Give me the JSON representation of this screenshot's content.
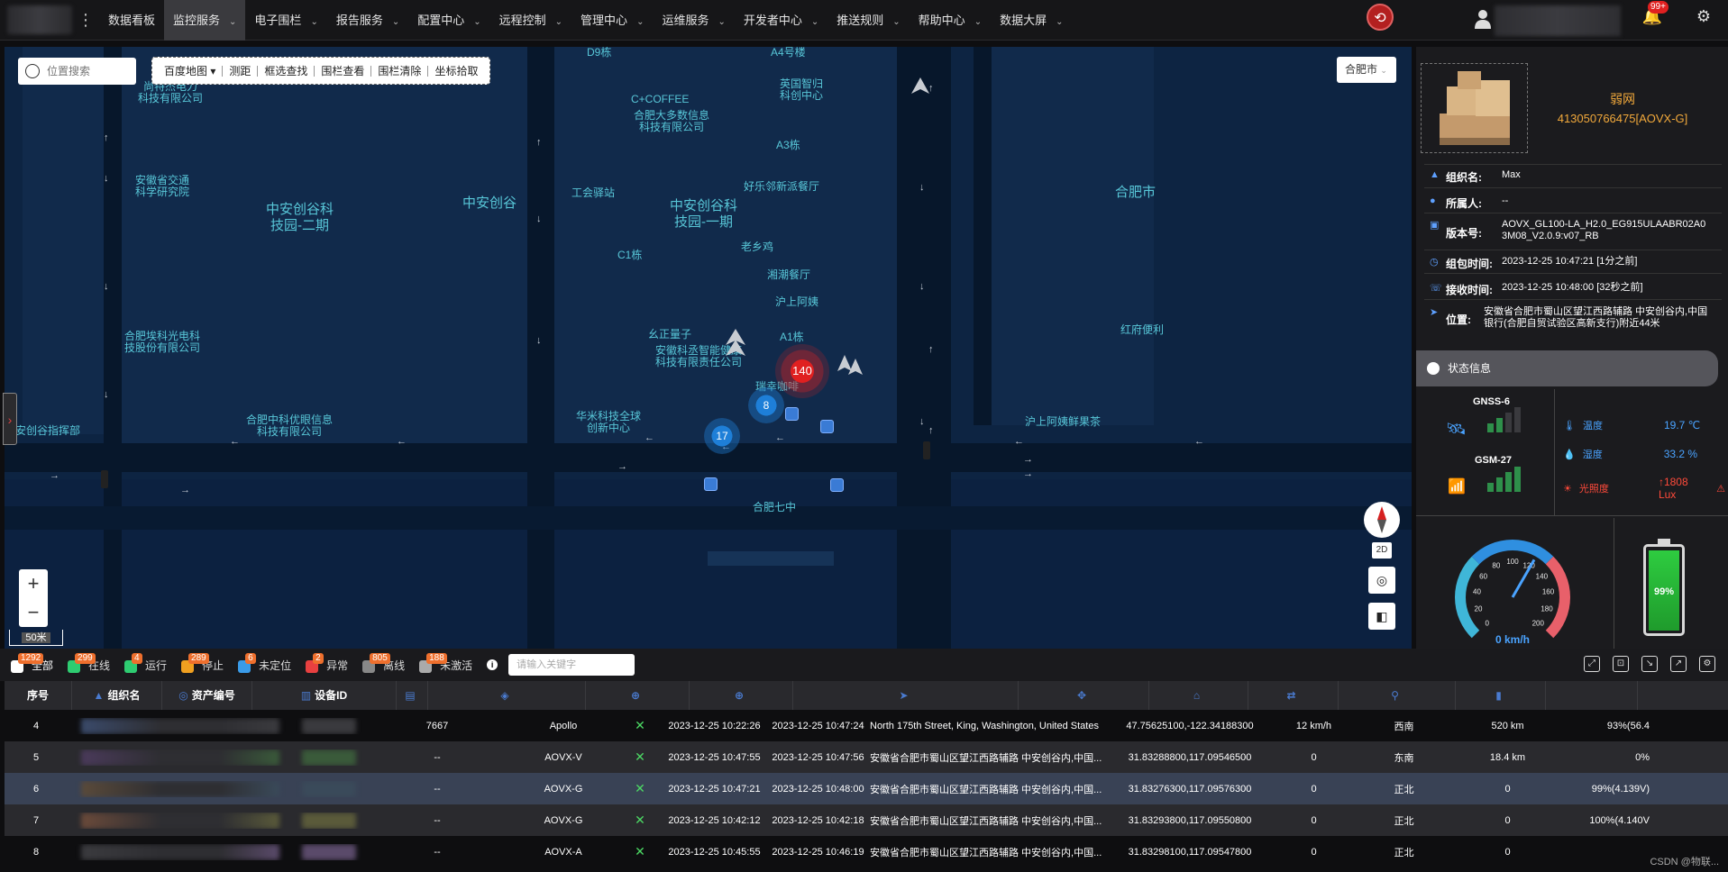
{
  "nav": {
    "items": [
      {
        "label": "数据看板",
        "dropdown": false
      },
      {
        "label": "监控服务",
        "dropdown": true,
        "active": true
      },
      {
        "label": "电子围栏",
        "dropdown": true
      },
      {
        "label": "报告服务",
        "dropdown": true
      },
      {
        "label": "配置中心",
        "dropdown": true
      },
      {
        "label": "远程控制",
        "dropdown": true
      },
      {
        "label": "管理中心",
        "dropdown": true
      },
      {
        "label": "运维服务",
        "dropdown": true
      },
      {
        "label": "开发者中心",
        "dropdown": true
      },
      {
        "label": "推送规则",
        "dropdown": true
      },
      {
        "label": "帮助中心",
        "dropdown": true
      },
      {
        "label": "数据大屏",
        "dropdown": true
      }
    ],
    "notification_count": "99+"
  },
  "map": {
    "search_placeholder": "位置搜索",
    "tools": [
      "百度地图",
      "测距",
      "框选查找",
      "围栏查看",
      "围栏清除",
      "坐标拾取"
    ],
    "city": "合肥市",
    "scale": "50米",
    "label_2d": "2D",
    "labels": [
      {
        "text": "尚特杰电力\n科技有限公司"
      },
      {
        "text": "安徽省交通\n科学研究院"
      },
      {
        "text": "中安创谷科\n技园-二期"
      },
      {
        "text": "中安创谷"
      },
      {
        "text": "合肥埃科光电科\n技股份有限公司"
      },
      {
        "text": "中安创谷指挥部"
      },
      {
        "text": "合肥中科优眼信息\n科技有限公司"
      },
      {
        "text": "D9栋"
      },
      {
        "text": "A4号楼"
      },
      {
        "text": "C+COFFEE"
      },
      {
        "text": "合肥大多数信息\n科技有限公司"
      },
      {
        "text": "英国智归\n科创中心"
      },
      {
        "text": "A3栋"
      },
      {
        "text": "工会驿站"
      },
      {
        "text": "中安创谷科\n技园-一期"
      },
      {
        "text": "好乐邻新派餐厅"
      },
      {
        "text": "老乡鸡"
      },
      {
        "text": "C1栋"
      },
      {
        "text": "湘潮餐厅"
      },
      {
        "text": "沪上阿姨"
      },
      {
        "text": "幺正量子"
      },
      {
        "text": "A1栋"
      },
      {
        "text": "安徽科丞智能健康\n科技有限责任公司"
      },
      {
        "text": "瑞幸咖啡"
      },
      {
        "text": "华米科技全球\n创新中心"
      },
      {
        "text": "合肥七中"
      },
      {
        "text": "沪上阿姨鲜果茶"
      },
      {
        "text": "合肥市"
      },
      {
        "text": "红府便利"
      }
    ],
    "clusters": [
      {
        "count": "140",
        "color": "#d81e1e"
      },
      {
        "count": "8",
        "color": "#1e7fd8"
      },
      {
        "count": "17",
        "color": "#1e7fd8"
      }
    ]
  },
  "device_panel": {
    "status": "弱网",
    "imei": "413050766475[AOVX-G]",
    "org_label": "组织名:",
    "org": "Max",
    "owner_label": "所属人:",
    "owner": "--",
    "version_label": "版本号:",
    "version": "AOVX_GL100-LA_H2.0_EG915ULAABR02A03M08_V2.0.9:v07_RB",
    "packet_time_label": "组包时间:",
    "packet_time": "2023-12-25 10:47:21 [1分之前]",
    "recv_time_label": "接收时间:",
    "recv_time": "2023-12-25 10:48:00 [32秒之前]",
    "location_label": "位置:",
    "location": "安徽省合肥市蜀山区望江西路辅路 中安创谷内,中国银行(合肥自贸试验区高新支行)附近44米",
    "status_title": "状态信息",
    "gnss_label": "GNSS-6",
    "gnss_level": 2,
    "gsm_label": "GSM-27",
    "gsm_level": 4,
    "temp_label": "温度",
    "temp": "19.7 ℃",
    "humidity_label": "湿度",
    "humidity": "33.2 %",
    "light_label": "光照度",
    "light": "↑1808 Lux",
    "speed": "0 km/h",
    "speed_ticks": [
      "0",
      "20",
      "40",
      "60",
      "80",
      "100",
      "120",
      "140",
      "160",
      "180",
      "200"
    ],
    "battery": "99%",
    "battery_level": 0.99
  },
  "filters": {
    "items": [
      {
        "label": "全部",
        "count": "1292",
        "color": "#ffffff",
        "active": true
      },
      {
        "label": "在线",
        "count": "299",
        "color": "#2ecc71"
      },
      {
        "label": "运行",
        "count": "4",
        "color": "#2ecc71"
      },
      {
        "label": "停止",
        "count": "289",
        "color": "#f0a020"
      },
      {
        "label": "未定位",
        "count": "6",
        "color": "#3a9be8"
      },
      {
        "label": "异常",
        "count": "2",
        "color": "#e84040"
      },
      {
        "label": "离线",
        "count": "805",
        "color": "#888888"
      },
      {
        "label": "未激活",
        "count": "188",
        "color": "#aaaaaa"
      }
    ],
    "keyword_placeholder": "请输入关键字"
  },
  "table": {
    "headers": [
      "序号",
      "组织名",
      "资产编号",
      "设备ID",
      "",
      "",
      "",
      "",
      "",
      "",
      "",
      "",
      "",
      "",
      ""
    ],
    "rows": [
      {
        "index": "4",
        "asset": "7667",
        "model": "Apollo",
        "pkt": "2023-12-25 10:22:26",
        "recv": "2023-12-25 10:47:24",
        "addr": "North 175th Street, King, Washington, United States",
        "coord": "47.75625100,-122.34188300",
        "speed": "12 km/h",
        "dir": "西南",
        "mileage": "520 km",
        "battery": "93%(56.4"
      },
      {
        "index": "5",
        "asset": "--",
        "model": "AOVX-V",
        "pkt": "2023-12-25 10:47:55",
        "recv": "2023-12-25 10:47:56",
        "addr": "安徽省合肥市蜀山区望江西路辅路 中安创谷内,中国...",
        "coord": "31.83288800,117.09546500",
        "speed": "0",
        "dir": "东南",
        "mileage": "18.4 km",
        "battery": "0%"
      },
      {
        "index": "6",
        "asset": "--",
        "model": "AOVX-G",
        "pkt": "2023-12-25 10:47:21",
        "recv": "2023-12-25 10:48:00",
        "addr": "安徽省合肥市蜀山区望江西路辅路 中安创谷内,中国...",
        "coord": "31.83276300,117.09576300",
        "speed": "0",
        "dir": "正北",
        "mileage": "0",
        "battery": "99%(4.139V)"
      },
      {
        "index": "7",
        "asset": "--",
        "model": "AOVX-G",
        "pkt": "2023-12-25 10:42:12",
        "recv": "2023-12-25 10:42:18",
        "addr": "安徽省合肥市蜀山区望江西路辅路 中安创谷内,中国...",
        "coord": "31.83293800,117.09550800",
        "speed": "0",
        "dir": "正北",
        "mileage": "0",
        "battery": "100%(4.140V"
      },
      {
        "index": "8",
        "asset": "--",
        "model": "AOVX-A",
        "pkt": "2023-12-25 10:45:55",
        "recv": "2023-12-25 10:46:19",
        "addr": "安徽省合肥市蜀山区望江西路辅路 中安创谷内,中国...",
        "coord": "31.83298100,117.09547800",
        "speed": "0",
        "dir": "正北",
        "mileage": "0",
        "battery": ""
      }
    ]
  },
  "watermark": "CSDN @物联..."
}
